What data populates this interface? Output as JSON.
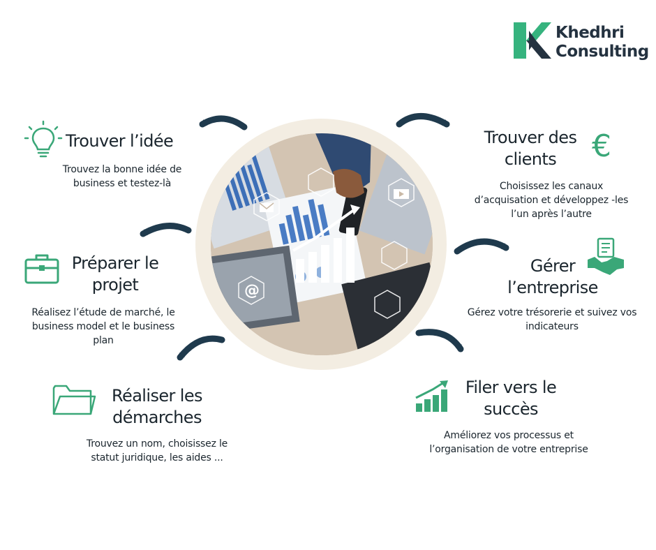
{
  "brand": {
    "line1": "Khedhri",
    "line2": "Consulting",
    "accent": "#36b37e",
    "dark": "#243240"
  },
  "colors": {
    "icon_green": "#3aa778",
    "arrow_navy": "#1f3a4d",
    "ring_beige": "#f3ede2"
  },
  "steps": [
    {
      "id": "trouver-idee",
      "title": "Trouver l’idée",
      "description": "Trouvez la bonne idée de business et testez-là",
      "icon": "lightbulb-icon"
    },
    {
      "id": "preparer-projet",
      "title_lines": [
        "Préparer le",
        "projet"
      ],
      "description": "Réalisez l’étude de marché, le business model et le business plan",
      "icon": "briefcase-icon"
    },
    {
      "id": "realiser-demarches",
      "title_lines": [
        "Réaliser les",
        "démarches"
      ],
      "description": "Trouvez un nom, choisissez le statut juridique, les aides ...",
      "icon": "folder-icon"
    },
    {
      "id": "trouver-clients",
      "title_lines": [
        "Trouver des",
        "clients"
      ],
      "description": "Choisissez les canaux d’acquisation et développez -les  l’un après l’autre",
      "icon": "euro-icon"
    },
    {
      "id": "gerer-entreprise",
      "title_lines": [
        "Gérer",
        "l’entreprise"
      ],
      "description": "Gérez votre trésorerie et suivez vos indicateurs",
      "icon": "handshake-document-icon"
    },
    {
      "id": "filer-succes",
      "title_lines": [
        "Filer vers le",
        "succès"
      ],
      "description": "Améliorez vos processus et l’organisation de votre entreprise",
      "icon": "growth-chart-icon"
    }
  ]
}
